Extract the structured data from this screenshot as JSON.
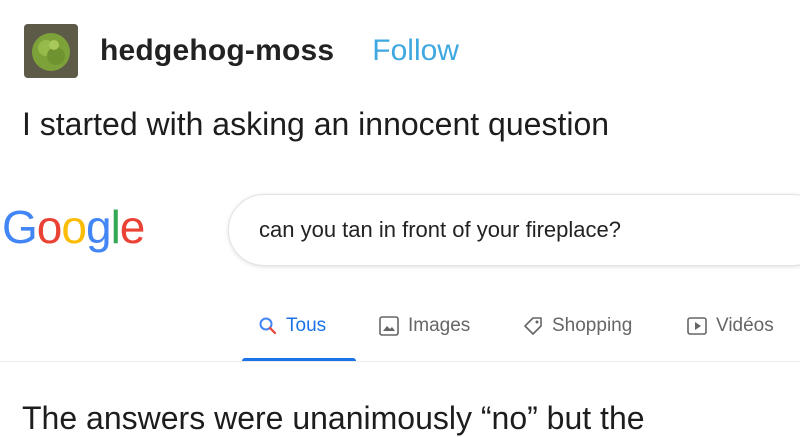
{
  "post": {
    "username": "hedgehog-moss",
    "follow_label": "Follow",
    "body_line_1": "I started with asking an innocent question",
    "body_line_2": "The answers were unanimously “no” but the"
  },
  "google": {
    "logo_letters": [
      "G",
      "o",
      "o",
      "g",
      "l",
      "e"
    ],
    "logo_colors": [
      "#4285F4",
      "#EA4335",
      "#FBBC05",
      "#4285F4",
      "#34A853",
      "#EA4335"
    ],
    "query": "can you tan in front of your fireplace?",
    "tabs": [
      {
        "label": "Tous",
        "icon": "search-icon",
        "active": true
      },
      {
        "label": "Images",
        "icon": "image-icon",
        "active": false
      },
      {
        "label": "Shopping",
        "icon": "tag-icon",
        "active": false
      },
      {
        "label": "Vidéos",
        "icon": "play-icon",
        "active": false
      }
    ],
    "accent_color": "#1a73e8"
  }
}
